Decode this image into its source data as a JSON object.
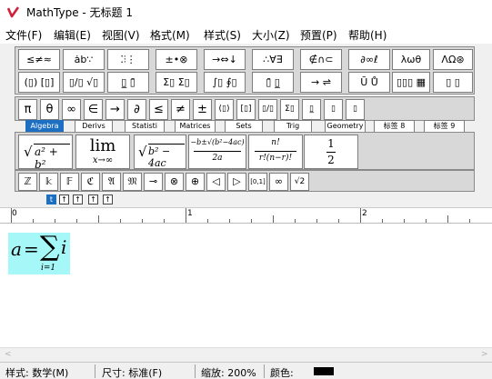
{
  "title": "MathType - 无标题 1",
  "menu": [
    "文件(F)",
    "编辑(E)",
    "视图(V)",
    "格式(M)",
    "样式(S)",
    "大小(Z)",
    "预置(P)",
    "帮助(H)"
  ],
  "palette_row1": [
    "≤≠≈",
    "ȧb∵",
    "⁚⫶⋮",
    "±•⊗",
    "→⇔↓",
    "∴∀∃",
    "∉∩⊂",
    "∂∞ℓ",
    "λωθ",
    "ΛΩ⊛"
  ],
  "palette_row2": [
    "(▯) [▯]",
    "▯/▯ √▯",
    "▯̲ ▯̄",
    "Σ▯ Σ▯",
    "∫▯ ∮▯",
    "▯̄ ▯̲",
    "→ ⇌",
    "Ū Ů",
    "▯▯▯ ▦",
    "▯ ▯"
  ],
  "symbols_row": [
    "π",
    "θ",
    "∞",
    "∈",
    "→",
    "∂",
    "≤",
    "≠",
    "±",
    "(▯)",
    "[▯]",
    "▯/▯",
    "Σ▯",
    "▯̲",
    "▯",
    "▯"
  ],
  "tabs": [
    "Algebra",
    "Derivs",
    "Statisti",
    "Matrices",
    "Sets",
    "Trig",
    "Geometry",
    "标签 8",
    "标签 9"
  ],
  "templates": {
    "pythag": "a² + b²",
    "lim": "lim",
    "lim_sub": "x→∞",
    "disc": "b² − 4ac",
    "quad_num": "−b±√(b²−4ac)",
    "quad_den": "2a",
    "binom_num": "n!",
    "binom_den": "r!(n−r)!",
    "frac_num": "1",
    "frac_den": "2"
  },
  "small_symbols": [
    "ℤ",
    "𝕜",
    "𝔽",
    "ℭ",
    "𝔄",
    "𝔐",
    "⊸",
    "⊗",
    "⊕",
    "◁",
    "▷",
    "[0,1]",
    "∞",
    "√2"
  ],
  "nudge_controls": [
    "t",
    "↑",
    "↑",
    "↑",
    "↑"
  ],
  "ruler": [
    "0",
    "1",
    "2"
  ],
  "equation": {
    "lhs": "a",
    "eq": "=",
    "sum": "∑",
    "body": "i",
    "sub": "i=1"
  },
  "status": {
    "style": "样式: 数学(M)",
    "size": "尺寸: 标准(F)",
    "zoom": "缩放: 200%",
    "color_label": "颜色:"
  },
  "colors": {
    "accent": "#1d6fc1",
    "highlight": "#a6f7f7",
    "logo": "#d0213a"
  }
}
